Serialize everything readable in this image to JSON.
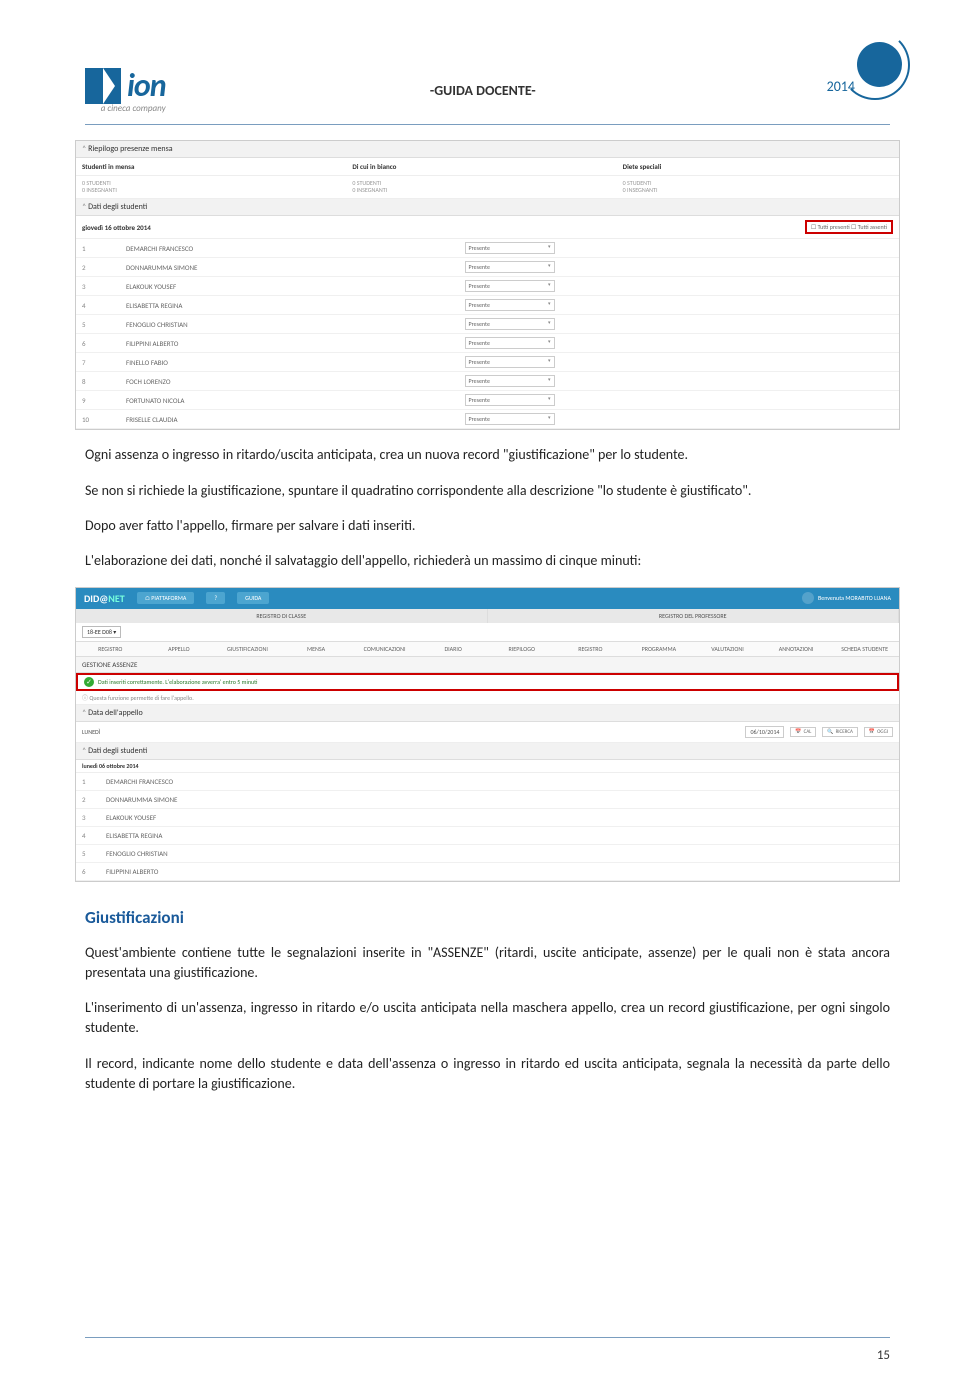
{
  "header": {
    "logo_text": "ion",
    "logo_sub": "a cineca company",
    "center": "-GUIDA DOCENTE-",
    "year": "2014"
  },
  "ss1": {
    "sec1": "Riepilogo presenze mensa",
    "col1_head": "Studenti in mensa",
    "col2_head": "Di cui in bianco",
    "col3_head": "Diete speciali",
    "col_val1": "0 STUDENTI",
    "col_val2": "0 INSEGNANTI",
    "sec2": "Dati degli studenti",
    "date": "giovedì 16 ottobre 2014",
    "btn_presenti": "Tutti presenti",
    "btn_assenti": "Tutti assenti",
    "presente": "Presente",
    "students": [
      {
        "n": "1",
        "name": "DEMARCHI FRANCESCO"
      },
      {
        "n": "2",
        "name": "DONNARUMMA SIMONE"
      },
      {
        "n": "3",
        "name": "ELAKOUK YOUSEF"
      },
      {
        "n": "4",
        "name": "ELISABETTA REGINA"
      },
      {
        "n": "5",
        "name": "FENOGLIO CHRISTIAN"
      },
      {
        "n": "6",
        "name": "FILIPPINI ALBERTO"
      },
      {
        "n": "7",
        "name": "FINELLO FABIO"
      },
      {
        "n": "8",
        "name": "FOCH LORENZO"
      },
      {
        "n": "9",
        "name": "FORTUNATO NICOLA"
      },
      {
        "n": "10",
        "name": "FRISELLE CLAUDIA"
      }
    ]
  },
  "para": {
    "p1": "Ogni assenza o ingresso in ritardo/uscita anticipata, crea un nuova record \"giustificazione\" per lo studente.",
    "p2": "Se non si richiede la giustificazione, spuntare il quadratino corrispondente alla descrizione \"lo studente è giustificato\".",
    "p3": "Dopo aver fatto l'appello, firmare per salvare i dati inseriti.",
    "p4": "L'elaborazione dei dati, nonché il salvataggio dell'appello, richiederà un massimo di cinque minuti:"
  },
  "ss2": {
    "logo_a": "DID@",
    "logo_b": "NET",
    "btn_piatt": "⌂ PIATTAFORMA",
    "btn_help": "?",
    "btn_guida": "GUIDA",
    "welcome": "Benvenuta MORABITO LUANA",
    "reg_classe": "REGISTRO DI CLASSE",
    "reg_prof": "REGISTRO DEL PROFESSORE",
    "class": "18-EE D08",
    "tabs": [
      "REGISTRO",
      "APPELLO",
      "GIUSTIFICAZIONI",
      "MENSA",
      "COMUNICAZIONI",
      "DIARIO",
      "RIEPILOGO",
      "REGISTRO",
      "PROGRAMMA",
      "VALUTAZIONI",
      "ANNOTAZIONI",
      "SCHEDA STUDENTE"
    ],
    "title": "GESTIONE ASSENZE",
    "msg": "Dati inseriti correttamente. L'elaborazione avverra' entro 5 minuti",
    "info": "ⓘ Questa funzione permette di fare l'appello.",
    "sec_data": "Data dell'appello",
    "day": "LUNEDÌ",
    "date": "06/10/2014",
    "btn_cal": "CAL",
    "btn_ricerca": "RICERCA",
    "btn_oggi": "OGGI",
    "sec_stud": "Dati degli studenti",
    "date_long": "lunedì 06 ottobre 2014",
    "students": [
      {
        "n": "1",
        "name": "DEMARCHI FRANCESCO"
      },
      {
        "n": "2",
        "name": "DONNARUMMA SIMONE"
      },
      {
        "n": "3",
        "name": "ELAKOUK YOUSEF"
      },
      {
        "n": "4",
        "name": "ELISABETTA REGINA"
      },
      {
        "n": "5",
        "name": "FENOGLIO CHRISTIAN"
      },
      {
        "n": "6",
        "name": "FILIPPINI ALBERTO"
      }
    ]
  },
  "sec_title": "Giustificazioni",
  "para2": {
    "p1": "Quest'ambiente contiene tutte le segnalazioni inserite in \"ASSENZE\" (ritardi, uscite anticipate, assenze) per le quali non è stata ancora presentata una giustificazione.",
    "p2": "L'inserimento di un'assenza, ingresso in ritardo e/o uscita anticipata nella maschera appello, crea un record giustificazione, per ogni singolo studente.",
    "p3": "Il record, indicante nome dello studente e data dell'assenza o ingresso in ritardo ed uscita anticipata, segnala la necessità da parte dello studente di portare la giustificazione."
  },
  "page_num": "15"
}
